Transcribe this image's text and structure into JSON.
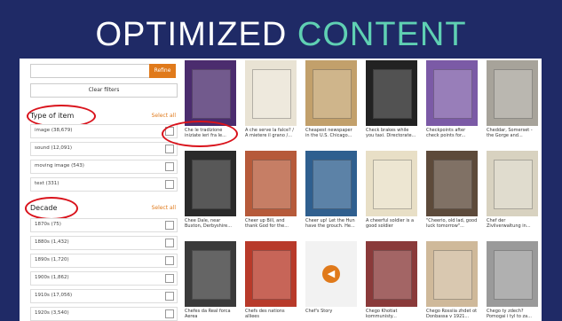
{
  "slide": {
    "title_main": "OPTIMIZED",
    "title_accent": "CONTENT"
  },
  "sidebar": {
    "search_value": "",
    "refine_label": "Refine",
    "clear_label": "Clear filters",
    "facet_type": {
      "title": "Type of item",
      "select_all": "Select all",
      "items": [
        "image (38,679)",
        "sound (12,091)",
        "moving image (543)",
        "text (331)"
      ]
    },
    "facet_decade": {
      "title": "Decade",
      "select_all": "Select all",
      "items": [
        "1870s (75)",
        "1880s (1,432)",
        "1890s (1,720)",
        "1900s (1,862)",
        "1910s (17,056)",
        "1920s (3,540)"
      ]
    }
  },
  "grid": {
    "items": [
      {
        "caption": "Che le tradizione iniziate ieri fra le...",
        "color": "#4b2c6e"
      },
      {
        "caption": "A che serve la falce? / A mietere il grano /...",
        "color": "#e9e3d4"
      },
      {
        "caption": "Cheapest newspaper in the U.S. Chicago...",
        "color": "#c2a06b"
      },
      {
        "caption": "Check brakes while you taxi. Directorate...",
        "color": "#222222"
      },
      {
        "caption": "Checkpoints after check points for...",
        "color": "#7b5aa6"
      },
      {
        "caption": "Cheddar, Somerset - the Gorge and...",
        "color": "#a7a39a"
      },
      {
        "caption": "Chee Dale, near Buxton, Derbyshire...",
        "color": "#2a2a2a"
      },
      {
        "caption": "Cheer up Bill, and thank God for the...",
        "color": "#b65a3a"
      },
      {
        "caption": "Cheer up! Let the Hun have the grouch. He...",
        "color": "#2f5f8f"
      },
      {
        "caption": "A cheerful soldier is a good soldier",
        "color": "#e8dfc6"
      },
      {
        "caption": "\"Cheerio, old lad, good luck tomorrow\"...",
        "color": "#5d4a3a"
      },
      {
        "caption": "Chef der Zivilverwaltung in...",
        "color": "#d8d2c0"
      },
      {
        "caption": "Chefes da Real forca Aerea",
        "color": "#3a3a3a"
      },
      {
        "caption": "Chefs des nations alliees",
        "color": "#b83a2a"
      },
      {
        "caption": "Chef's Story",
        "color": "#ffffff"
      },
      {
        "caption": "Chego Khotiat kommunisty...",
        "color": "#8a3a3a"
      },
      {
        "caption": "Chego Rossiia zhdet ot Donbassa v 1921...",
        "color": "#cfb99a"
      },
      {
        "caption": "Chego ty zdech? Pomogai i tyl to za...",
        "color": "#9a9a9a"
      }
    ]
  }
}
